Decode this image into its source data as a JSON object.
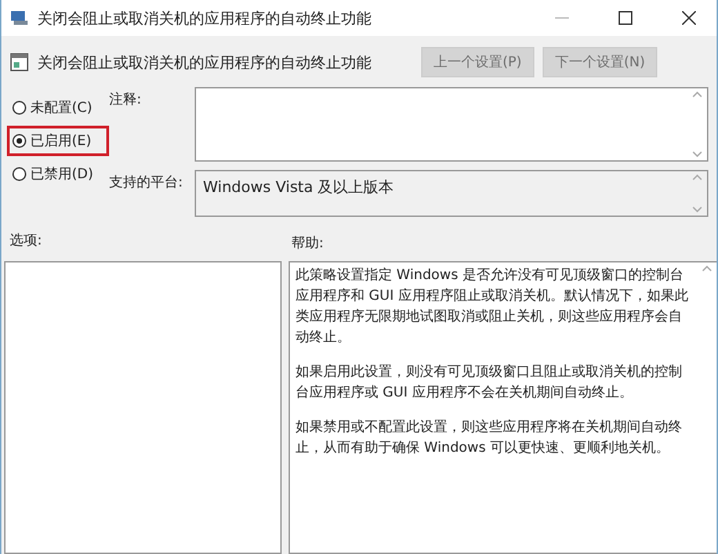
{
  "window": {
    "title": "关闭会阻止或取消关机的应用程序的自动终止功能"
  },
  "header": {
    "title": "关闭会阻止或取消关机的应用程序的自动终止功能",
    "buttons": [
      {
        "label": "上一个设置(P)",
        "disabled": true
      },
      {
        "label": "下一个设置(N)",
        "disabled": true
      }
    ]
  },
  "state_options": [
    {
      "label": "未配置(C)",
      "selected": false,
      "highlighted": false
    },
    {
      "label": "已启用(E)",
      "selected": true,
      "highlighted": true
    },
    {
      "label": "已禁用(D)",
      "selected": false,
      "highlighted": false
    }
  ],
  "comment": {
    "label": "注释:"
  },
  "platform": {
    "label": "支持的平台:",
    "value": "Windows Vista 及以上版本"
  },
  "options": {
    "label": "选项:"
  },
  "help": {
    "label": "帮助:",
    "paragraphs": [
      "此策略设置指定 Windows 是否允许没有可见顶级窗口的控制台应用程序和 GUI 应用程序阻止或取消关机。默认情况下，如果此类应用程序无限期地试图取消或阻止关机，则这些应用程序会自动终止。",
      "如果启用此设置，则没有可见顶级窗口且阻止或取消关机的控制台应用程序或 GUI 应用程序不会在关机期间自动终止。",
      "如果禁用或不配置此设置，则这些应用程序将在关机期间自动终止，从而有助于确保 Windows 可以更快速、更顺利地关机。"
    ]
  }
}
